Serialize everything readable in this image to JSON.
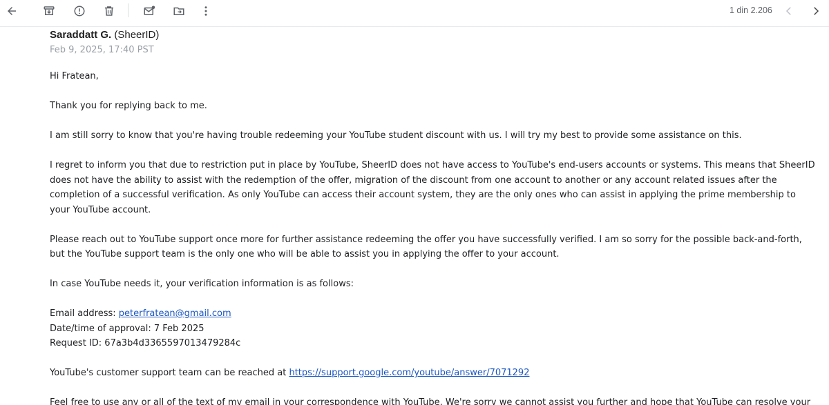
{
  "toolbar": {
    "back_icon": "arrow-left-icon",
    "archive_icon": "archive-icon",
    "report_icon": "report-spam-icon",
    "delete_icon": "trash-icon",
    "unread_icon": "mark-unread-icon",
    "move_icon": "move-to-folder-icon",
    "more_icon": "more-vertical-icon",
    "counter": "1 din 2.206",
    "prev_icon": "chevron-left-icon",
    "next_icon": "chevron-right-icon"
  },
  "message": {
    "sender_name": "Saraddatt G.",
    "sender_org": " (SheerID)",
    "date": "Feb 9, 2025, 17:40 PST",
    "greeting": "Hi Fratean,",
    "p1": "Thank you for replying back to me.",
    "p2": "I am still sorry to know that you're having trouble redeeming your YouTube student discount with us. I will try my best to provide some assistance on this.",
    "p3": "I regret to inform you that due to restriction put in place by YouTube, SheerID does not have access to YouTube's end-users accounts or systems. This means that SheerID does not have the ability to assist with the redemption of the offer, migration of the discount from one account to another or any account related issues after the completion of a successful verification. As only YouTube can access their account system, they are the only ones who can assist in applying the prime membership to your YouTube account.",
    "p4": "Please reach out to YouTube support once more for further assistance redeeming the offer you have successfully verified. I am so sorry for the possible back-and-forth, but the YouTube support team is the only one who will be able to assist you in applying the offer to your account.",
    "p5": "In case YouTube needs it, your verification information is as follows:",
    "email_label": "Email address: ",
    "email_value": "peterfratean@gmail.com",
    "approval_line": "Date/time of approval: 7 Feb 2025",
    "request_line": "Request ID: 67a3b4d3365597013479284c",
    "support_text": "YouTube's customer support team can be reached at ",
    "support_link": "https://support.google.com/youtube/answer/7071292",
    "p_last": "Feel free to use any or all of the text of my email in your correspondence with YouTube. We're sorry we cannot assist you further and hope that YouTube can resolve your problem soon."
  }
}
